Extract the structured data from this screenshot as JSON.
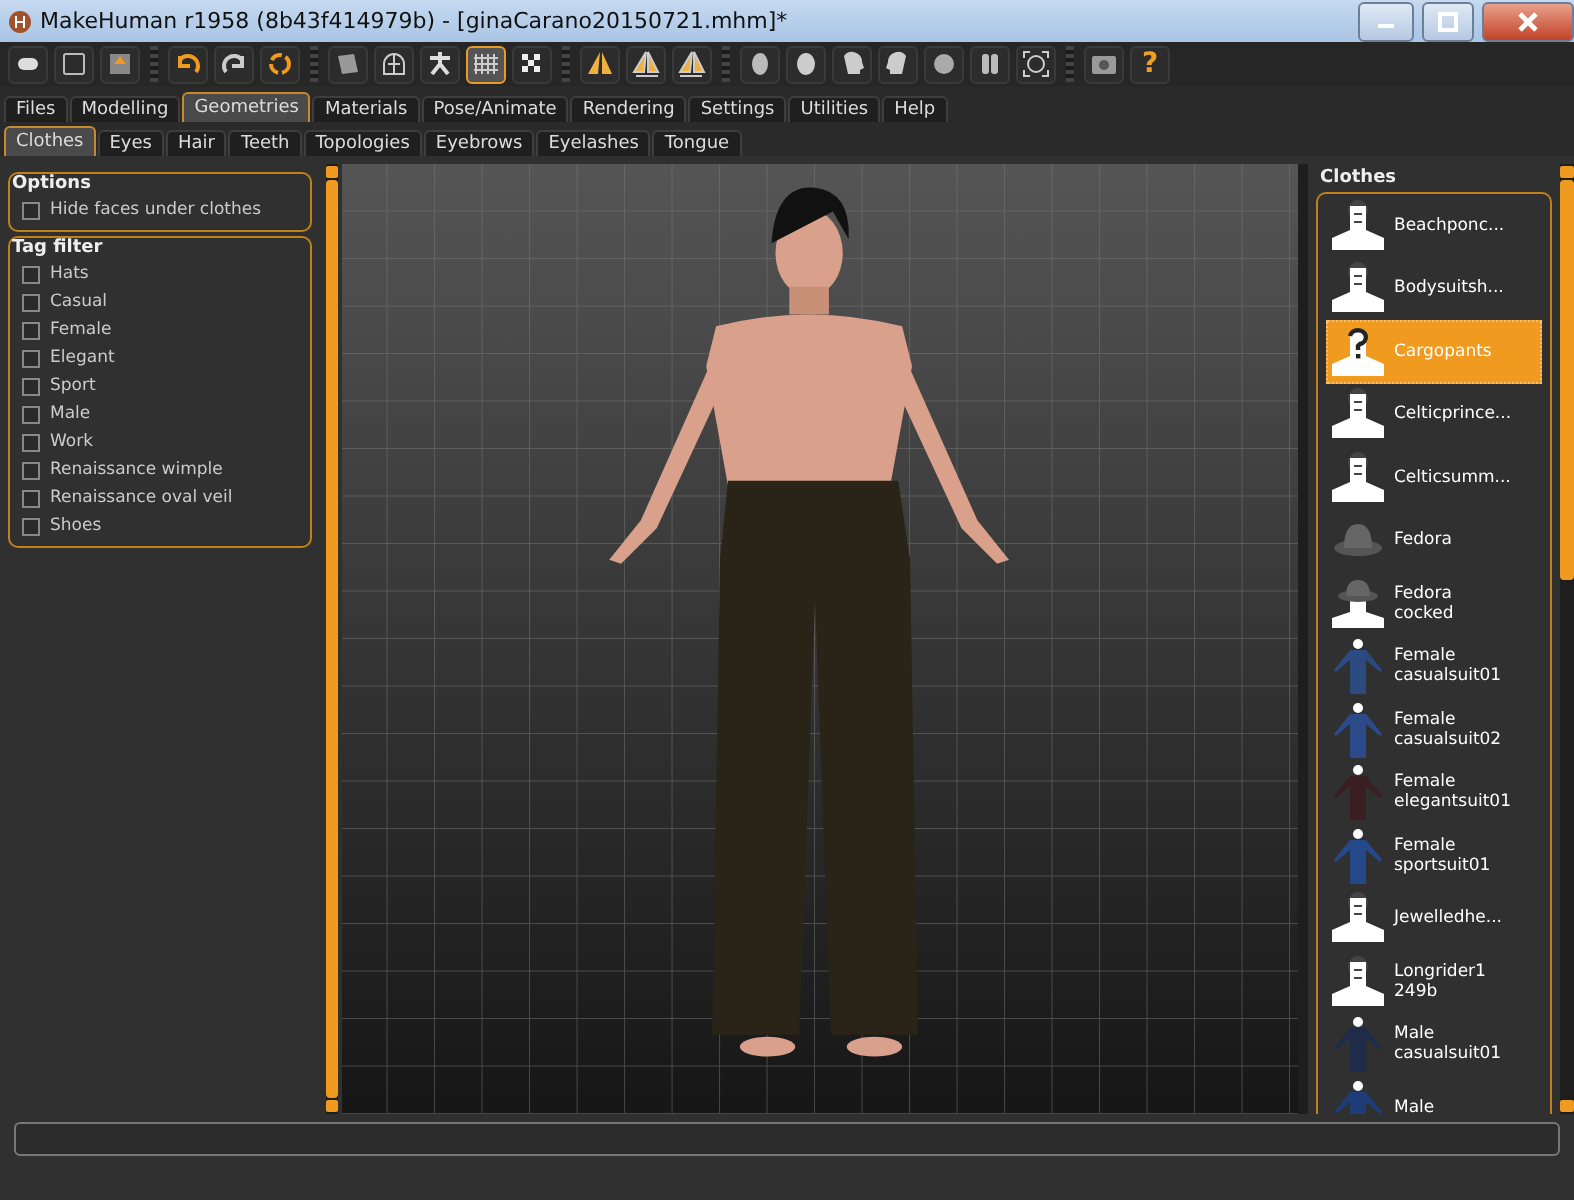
{
  "window": {
    "title": "MakeHuman r1958 (8b43f414979b) - [ginaCarano20150721.mhm]*"
  },
  "toolbar": [
    {
      "group": [
        {
          "on": false
        },
        {
          "on": false
        },
        {
          "on": false
        }
      ]
    },
    {
      "group": [
        {
          "on": false
        },
        {
          "on": false
        },
        {
          "on": false
        }
      ]
    },
    {
      "group": [
        {
          "on": false
        },
        {
          "on": false
        },
        {
          "on": false
        },
        {
          "on": true
        },
        {
          "on": false
        }
      ]
    },
    {
      "group": [
        {
          "on": false
        },
        {
          "on": false
        },
        {
          "on": false
        }
      ]
    },
    {
      "group": [
        {
          "on": false
        },
        {
          "on": false
        },
        {
          "on": false
        },
        {
          "on": false
        },
        {
          "on": false
        },
        {
          "on": false
        },
        {
          "on": false
        }
      ]
    },
    {
      "group": [
        {
          "on": false
        },
        {
          "on": false,
          "label": "?"
        }
      ]
    }
  ],
  "tabs": [
    {
      "label": "Files",
      "selected": false
    },
    {
      "label": "Modelling",
      "selected": false
    },
    {
      "label": "Geometries",
      "selected": true
    },
    {
      "label": "Materials",
      "selected": false
    },
    {
      "label": "Pose/Animate",
      "selected": false
    },
    {
      "label": "Rendering",
      "selected": false
    },
    {
      "label": "Settings",
      "selected": false
    },
    {
      "label": "Utilities",
      "selected": false
    },
    {
      "label": "Help",
      "selected": false
    }
  ],
  "subtabs": [
    {
      "label": "Clothes",
      "selected": true
    },
    {
      "label": "Eyes",
      "selected": false
    },
    {
      "label": "Hair",
      "selected": false
    },
    {
      "label": "Teeth",
      "selected": false
    },
    {
      "label": "Topologies",
      "selected": false
    },
    {
      "label": "Eyebrows",
      "selected": false
    },
    {
      "label": "Eyelashes",
      "selected": false
    },
    {
      "label": "Tongue",
      "selected": false
    }
  ],
  "options": {
    "title": "Options",
    "items": [
      {
        "label": "Hide faces under clothes",
        "checked": false
      }
    ]
  },
  "tag_filter": {
    "title": "Tag filter",
    "items": [
      {
        "label": "Hats",
        "checked": false
      },
      {
        "label": "Casual",
        "checked": false
      },
      {
        "label": "Female",
        "checked": false
      },
      {
        "label": "Elegant",
        "checked": false
      },
      {
        "label": "Sport",
        "checked": false
      },
      {
        "label": "Male",
        "checked": false
      },
      {
        "label": "Work",
        "checked": false
      },
      {
        "label": "Renaissance wimple",
        "checked": false
      },
      {
        "label": "Renaissance oval veil",
        "checked": false
      },
      {
        "label": "Shoes",
        "checked": false
      }
    ]
  },
  "clothes": {
    "title": "Clothes",
    "items": [
      {
        "label": "Beachponc...",
        "kind": "blank",
        "selected": false
      },
      {
        "label": "Bodysuitsh...",
        "kind": "blank",
        "selected": false
      },
      {
        "label": "Cargopants",
        "kind": "unknown",
        "selected": true
      },
      {
        "label": "Celticprince...",
        "kind": "blank",
        "selected": false
      },
      {
        "label": "Celticsumm...",
        "kind": "blank",
        "selected": false
      },
      {
        "label": "Fedora",
        "kind": "hat",
        "selected": false
      },
      {
        "label": "Fedora cocked",
        "kind": "hat-figure",
        "selected": false
      },
      {
        "label": "Female casualsuit01",
        "kind": "outfit",
        "color": "#2a4a80",
        "selected": false
      },
      {
        "label": "Female casualsuit02",
        "kind": "outfit",
        "color": "#2a4a8a",
        "selected": false
      },
      {
        "label": "Female elegantsuit01",
        "kind": "outfit",
        "color": "#3a1e22",
        "selected": false
      },
      {
        "label": "Female sportsuit01",
        "kind": "outfit",
        "color": "#24488a",
        "selected": false
      },
      {
        "label": "Jewelledhe...",
        "kind": "blank",
        "selected": false
      },
      {
        "label": "Longrider1 249b",
        "kind": "blank",
        "selected": false
      },
      {
        "label": "Male casualsuit01",
        "kind": "outfit",
        "color": "#1e2c4a",
        "selected": false
      },
      {
        "label": "Male",
        "kind": "outfit",
        "color": "#1e3c78",
        "selected": false
      }
    ]
  }
}
